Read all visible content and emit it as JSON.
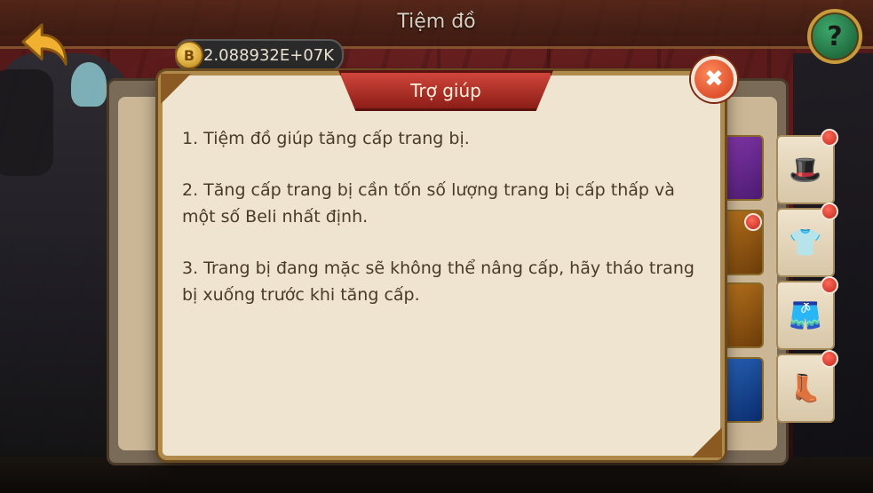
{
  "topbar": {
    "title": "Tiệm đồ",
    "help_symbol": "?"
  },
  "currency": {
    "amount": "2.088932E+07K",
    "icon": "coin-icon",
    "icon_symbol": "B"
  },
  "modal": {
    "title": "Trợ giúp",
    "close_symbol": "✖",
    "paragraphs": [
      "1. Tiệm đồ giúp tăng cấp trang bị.",
      "2. Tăng cấp trang bị cần tốn số lượng trang bị cấp thấp và một số Beli nhất định.",
      "3. Trang bị đang mặc sẽ không thể nâng cấp, hãy tháo trang bị xuống trước khi tăng cấp."
    ]
  },
  "tabs": [
    {
      "name": "hat",
      "icon": "hat-icon",
      "glyph": "🎩"
    },
    {
      "name": "shirt",
      "icon": "shirt-icon",
      "glyph": "👕"
    },
    {
      "name": "pants",
      "icon": "pants-icon",
      "glyph": "🩳"
    },
    {
      "name": "boots",
      "icon": "boots-icon",
      "glyph": "👢"
    }
  ],
  "colors": {
    "modal_bg": "#eee4cf",
    "header_red": "#c0382e",
    "text_brown": "#4a3a2a",
    "help_green": "#2e8a52",
    "notification_red": "#d0342a"
  }
}
